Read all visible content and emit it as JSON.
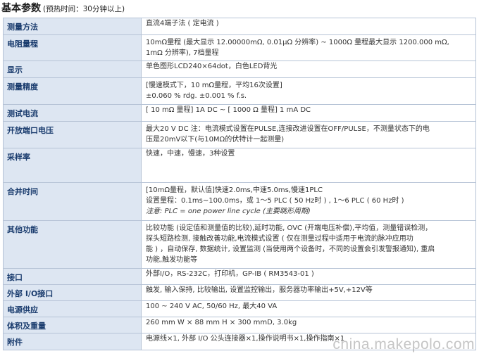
{
  "heading": {
    "title": "基本参数",
    "subtitle": "(预热时间：30分钟以上)"
  },
  "rows": [
    {
      "label": "测量方法",
      "lines": [
        "直流4端子法 ( 定电流 )"
      ]
    },
    {
      "label": "电阻量程",
      "lines": [
        "10mΩ量程 (最大显示 12.00000mΩ, 0.01μΩ 分辨率) ~ 1000Ω 量程最大显示 1200.000 mΩ,",
        "1mΩ 分辨率), 7档量程"
      ]
    },
    {
      "label": "显示",
      "lines": [
        "单色图形LCD240×64dot，白色LED背光"
      ]
    },
    {
      "label": "测量精度",
      "lines": [
        "[慢速模式下，10 mΩ量程，平均16次设置]",
        "±0.060 % rdg. ±0.001 % f.s."
      ]
    },
    {
      "label": "测试电流",
      "lines": [
        "[ 10 mΩ 量程] 1A DC ~ [ 1000 Ω 量程] 1 mA DC"
      ]
    },
    {
      "label": "开放端口电压",
      "lines": [
        "最大20 V DC 注：电流模式设置在PULSE,连接改进设置在OFF/PULSE，不测量状态下的电",
        "压是20mV以下(与10MΩ的伏特计一起测量)"
      ]
    },
    {
      "label": "采样率",
      "lines": [
        "快速，中速，慢速，3种设置"
      ]
    },
    {
      "label": "合并时间",
      "lines": [
        "[10mΩ量程，默认值]快速2.0ms,中速5.0ms,慢速1PLC",
        "设置量程：0.1ms~100.0ms，或 1～5 PLC ( 50 Hz时 ) , 1～6 PLC ( 60 Hz时 )"
      ],
      "note": "注意: PLC = one power line cycle (主要跳形周期)"
    },
    {
      "label": "其他功能",
      "lines": [
        "比较功能 (设定值和测量值的比较),延时功能, OVC (开端电压补偿),平均值，测量错误检测，",
        "探头短路检测, 接触改善功能,电流模式设置 ( 仅在测量过程中适用于电流的脉冲应用功",
        "能 ) ，自动保存, 数据统计, 设置监测 (当使用两个设备时，不同的设置会引发警报通知), 重启",
        "功能,触发功能等"
      ]
    },
    {
      "label": "接口",
      "lines": [
        "外部I/O，RS-232C，打印机，GP-IB ( RM3543-01 )"
      ]
    },
    {
      "label": "外部 I/O接口",
      "lines": [
        "触发, 输入保持, 比较输出, 设置监控输出，服务器功率输出+5V,+12V等"
      ]
    },
    {
      "label": "电源供应",
      "lines": [
        "100 ~ 240 V AC, 50/60 Hz, 最大40 VA"
      ]
    },
    {
      "label": "体积及重量",
      "lines": [
        "260 mm W × 88 mm H × 300 mmD, 3.0kg"
      ]
    },
    {
      "label": "附件",
      "lines": [
        "电源线×1, 外部 I/O 公头连接器×1,操作说明书×1,操作指南×1"
      ]
    }
  ],
  "watermark": "china.makepolo.com"
}
